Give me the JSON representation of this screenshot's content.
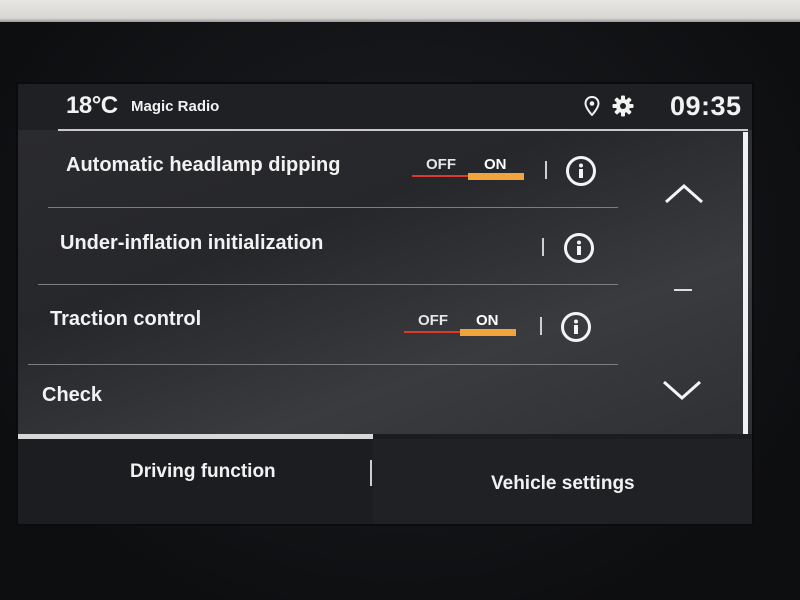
{
  "status_bar": {
    "temperature": "18°C",
    "source": "Magic Radio",
    "time": "09:35",
    "icons": [
      "location-icon",
      "gear-icon"
    ]
  },
  "settings": [
    {
      "label": "Automatic headlamp dipping",
      "toggle": {
        "off_label": "OFF",
        "on_label": "ON",
        "state": "ON"
      },
      "info": true
    },
    {
      "label": "Under-inflation initialization",
      "toggle": null,
      "info": true
    },
    {
      "label": "Traction control",
      "toggle": {
        "off_label": "OFF",
        "on_label": "ON",
        "state": "ON"
      },
      "info": true
    },
    {
      "label": "Check",
      "toggle": null,
      "info": false
    }
  ],
  "scroll": {
    "icons": [
      "chevron-up-icon",
      "chevron-down-icon"
    ]
  },
  "tabs": [
    {
      "label": "Driving function",
      "active": true
    },
    {
      "label": "Vehicle settings",
      "active": false
    }
  ],
  "colors": {
    "toggle_track": "#d83b2a",
    "toggle_on": "#f1a43b",
    "background": "#26272b"
  }
}
